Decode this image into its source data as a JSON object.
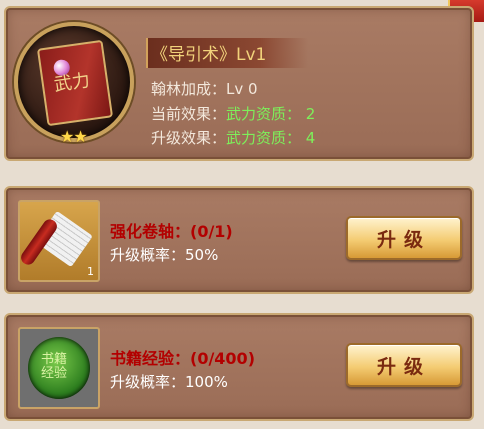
{
  "book": {
    "title": "《导引术》Lv1",
    "line1_label": "翰林加成：",
    "line1_value": "Lv 0",
    "line2_label": "当前效果：",
    "line2_value": "武力资质：  2",
    "line3_label": "升级效果：",
    "line3_value": "武力资质：  4",
    "stars": 2,
    "cover_char": "武力"
  },
  "rows": [
    {
      "requirement": "强化卷轴：(0/1)",
      "rate": "升级概率：50%",
      "count": "1",
      "button": "升级"
    },
    {
      "requirement": "书籍经验：(0/400)",
      "rate": "升级概率：100%",
      "button": "升级"
    }
  ],
  "colors": {
    "requirement_text": "#b30000",
    "effect_value": "#7df05a",
    "title_text": "#f1d27b"
  },
  "icons": [
    "book-icon",
    "scroll-icon",
    "jade-token-icon",
    "star-icon"
  ]
}
